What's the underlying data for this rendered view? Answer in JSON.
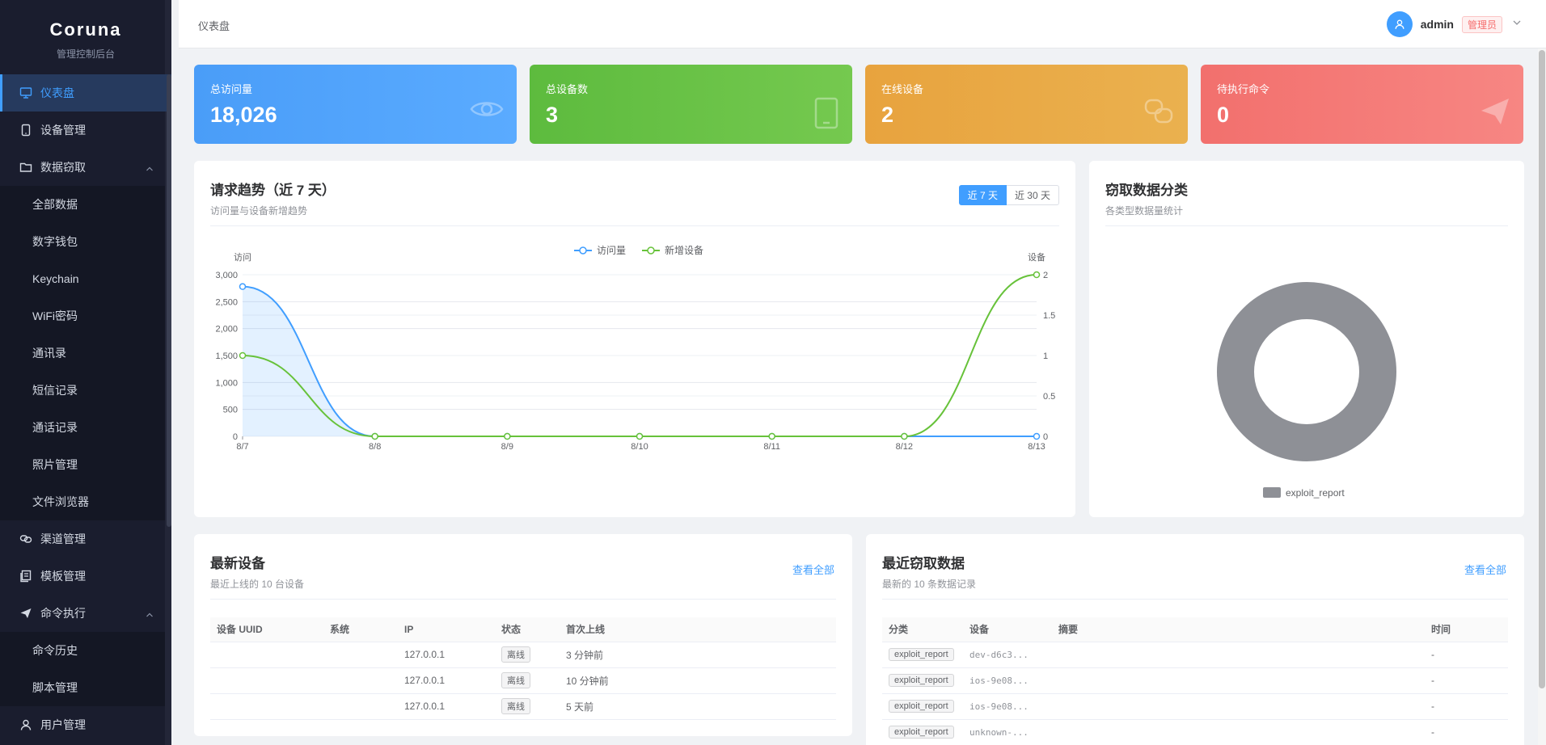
{
  "app": {
    "title": "Coruna",
    "subtitle": "管理控制后台"
  },
  "sidebar": {
    "items": [
      {
        "label": "仪表盘",
        "icon": "dashboard-icon",
        "active": true
      },
      {
        "label": "设备管理",
        "icon": "device-icon"
      },
      {
        "label": "数据窃取",
        "icon": "folder-icon",
        "expanded": true,
        "children": [
          "全部数据",
          "数字钱包",
          "Keychain",
          "WiFi密码",
          "通讯录",
          "短信记录",
          "通话记录",
          "照片管理",
          "文件浏览器"
        ]
      },
      {
        "label": "渠道管理",
        "icon": "link-icon"
      },
      {
        "label": "模板管理",
        "icon": "template-icon"
      },
      {
        "label": "命令执行",
        "icon": "send-icon",
        "expanded": true,
        "children": [
          "命令历史",
          "脚本管理"
        ]
      },
      {
        "label": "用户管理",
        "icon": "user-icon"
      }
    ]
  },
  "header": {
    "breadcrumb": "仪表盘",
    "username": "admin",
    "role": "管理员"
  },
  "stats": [
    {
      "label": "总访问量",
      "value": "18,026",
      "icon": "eye-icon"
    },
    {
      "label": "总设备数",
      "value": "3",
      "icon": "tablet-icon"
    },
    {
      "label": "在线设备",
      "value": "2",
      "icon": "link-icon"
    },
    {
      "label": "待执行命令",
      "value": "0",
      "icon": "send-icon"
    }
  ],
  "trend": {
    "title": "请求趋势（近 7 天）",
    "subtitle": "访问量与设备新增趋势",
    "range_7": "近 7 天",
    "range_30": "近 30 天",
    "chart_data": {
      "type": "line",
      "categories": [
        "8/7",
        "8/8",
        "8/9",
        "8/10",
        "8/11",
        "8/12",
        "8/13"
      ],
      "series": [
        {
          "name": "访问量",
          "axis": "left",
          "color": "#409eff",
          "values": [
            2780,
            0,
            0,
            0,
            0,
            0,
            0
          ]
        },
        {
          "name": "新增设备",
          "axis": "right",
          "color": "#67c23a",
          "values": [
            1,
            0,
            0,
            0,
            0,
            0,
            2
          ]
        }
      ],
      "ylabel_left": "访问",
      "ylabel_right": "设备",
      "ylim_left": [
        0,
        3000
      ],
      "ylim_right": [
        0,
        2
      ],
      "yticks_left": [
        "0",
        "500",
        "1,000",
        "1,500",
        "2,000",
        "2,500",
        "3,000"
      ],
      "yticks_right": [
        "0",
        "0.5",
        "1",
        "1.5",
        "2"
      ],
      "legend": "top-center",
      "grid": true
    }
  },
  "category": {
    "title": "窃取数据分类",
    "subtitle": "各类型数据量统计",
    "chart_data": {
      "type": "pie",
      "donut": true,
      "categories": [
        "exploit_report"
      ],
      "values": [
        1
      ],
      "colors": [
        "#8e9096"
      ],
      "legend": "bottom"
    }
  },
  "devices": {
    "title": "最新设备",
    "subtitle": "最近上线的 10 台设备",
    "view_all": "查看全部",
    "columns": [
      "设备 UUID",
      "系统",
      "IP",
      "状态",
      "首次上线"
    ],
    "rows": [
      {
        "uuid": "",
        "os": "",
        "ip": "127.0.0.1",
        "status": "离线",
        "first": "3 分钟前"
      },
      {
        "uuid": "",
        "os": "",
        "ip": "127.0.0.1",
        "status": "离线",
        "first": "10 分钟前"
      },
      {
        "uuid": "",
        "os": "",
        "ip": "127.0.0.1",
        "status": "离线",
        "first": "5 天前"
      }
    ]
  },
  "recent": {
    "title": "最近窃取数据",
    "subtitle": "最新的 10 条数据记录",
    "view_all": "查看全部",
    "columns": [
      "分类",
      "设备",
      "摘要",
      "时间"
    ],
    "rows": [
      {
        "cat": "exploit_report",
        "device": "dev-d6c3...",
        "summary": "",
        "time": "-"
      },
      {
        "cat": "exploit_report",
        "device": "ios-9e08...",
        "summary": "",
        "time": "-"
      },
      {
        "cat": "exploit_report",
        "device": "ios-9e08...",
        "summary": "",
        "time": "-"
      },
      {
        "cat": "exploit_report",
        "device": "unknown-...",
        "summary": "",
        "time": "-"
      }
    ]
  }
}
